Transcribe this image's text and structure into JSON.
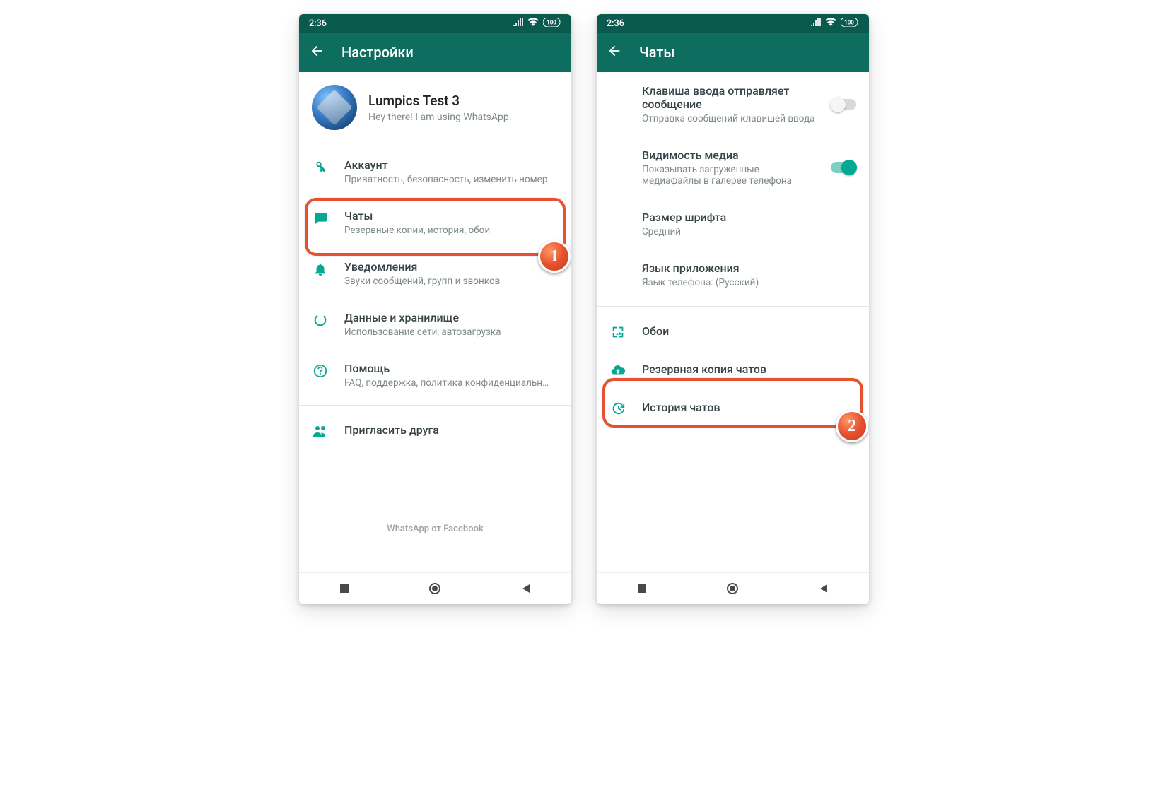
{
  "status": {
    "time": "2:36",
    "battery": "100"
  },
  "colors": {
    "teal": "#0d6d5f",
    "accent": "#06a894",
    "highlight": "#e6522f"
  },
  "steps": {
    "one": "1",
    "two": "2"
  },
  "left": {
    "appbar_title": "Настройки",
    "profile": {
      "name": "Lumpics Test 3",
      "status": "Hey there! I am using WhatsApp."
    },
    "items": [
      {
        "icon": "key",
        "title": "Аккаунт",
        "sub": "Приватность, безопасность, изменить номер"
      },
      {
        "icon": "chat",
        "title": "Чаты",
        "sub": "Резервные копии, история, обои"
      },
      {
        "icon": "bell",
        "title": "Уведомления",
        "sub": "Звуки сообщений, групп и звонков"
      },
      {
        "icon": "data",
        "title": "Данные и хранилище",
        "sub": "Использование сети, автозагрузка"
      },
      {
        "icon": "help",
        "title": "Помощь",
        "sub": "FAQ, поддержка, политика конфиденциальн…"
      },
      {
        "icon": "people",
        "title": "Пригласить друга",
        "sub": ""
      }
    ],
    "footer": "WhatsApp от Facebook"
  },
  "right": {
    "appbar_title": "Чаты",
    "toggles": [
      {
        "title": "Клавиша ввода отправляет сообщение",
        "sub": "Отправка сообщений клавишей ввода",
        "on": false
      },
      {
        "title": "Видимость медиа",
        "sub": "Показывать загруженные медиафайлы в галерее телефона",
        "on": true
      }
    ],
    "plain": [
      {
        "title": "Размер шрифта",
        "sub": "Средний"
      },
      {
        "title": "Язык приложения",
        "sub": "Язык телефона: (Русский)"
      }
    ],
    "icon_items": [
      {
        "icon": "wallpaper",
        "title": "Обои"
      },
      {
        "icon": "cloud",
        "title": "Резервная копия чатов"
      },
      {
        "icon": "history",
        "title": "История чатов"
      }
    ]
  }
}
